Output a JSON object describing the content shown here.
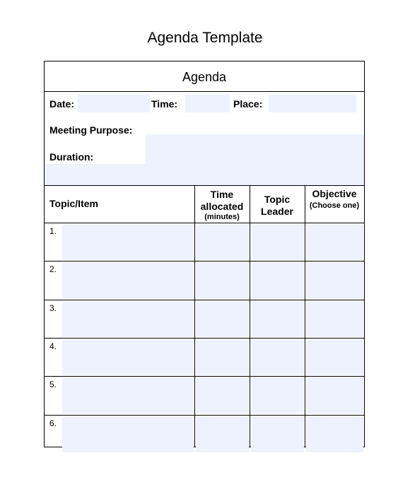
{
  "document": {
    "title": "Agenda Template",
    "header": "Agenda",
    "fields": {
      "date_label": "Date:",
      "time_label": "Time:",
      "place_label": "Place:",
      "purpose_label": "Meeting Purpose:",
      "duration_label": "Duration:"
    },
    "table": {
      "columns": [
        {
          "label": "Topic/Item",
          "sub": ""
        },
        {
          "label": "Time allocated",
          "sub": "(minutes)"
        },
        {
          "label": "Topic Leader",
          "sub": ""
        },
        {
          "label": "Objective",
          "sub": "(Choose one)"
        }
      ],
      "rows": [
        "1.",
        "2.",
        "3.",
        "4.",
        "5.",
        "6."
      ]
    },
    "colors": {
      "field_fill": "#eef2fd",
      "border": "#000000"
    }
  }
}
